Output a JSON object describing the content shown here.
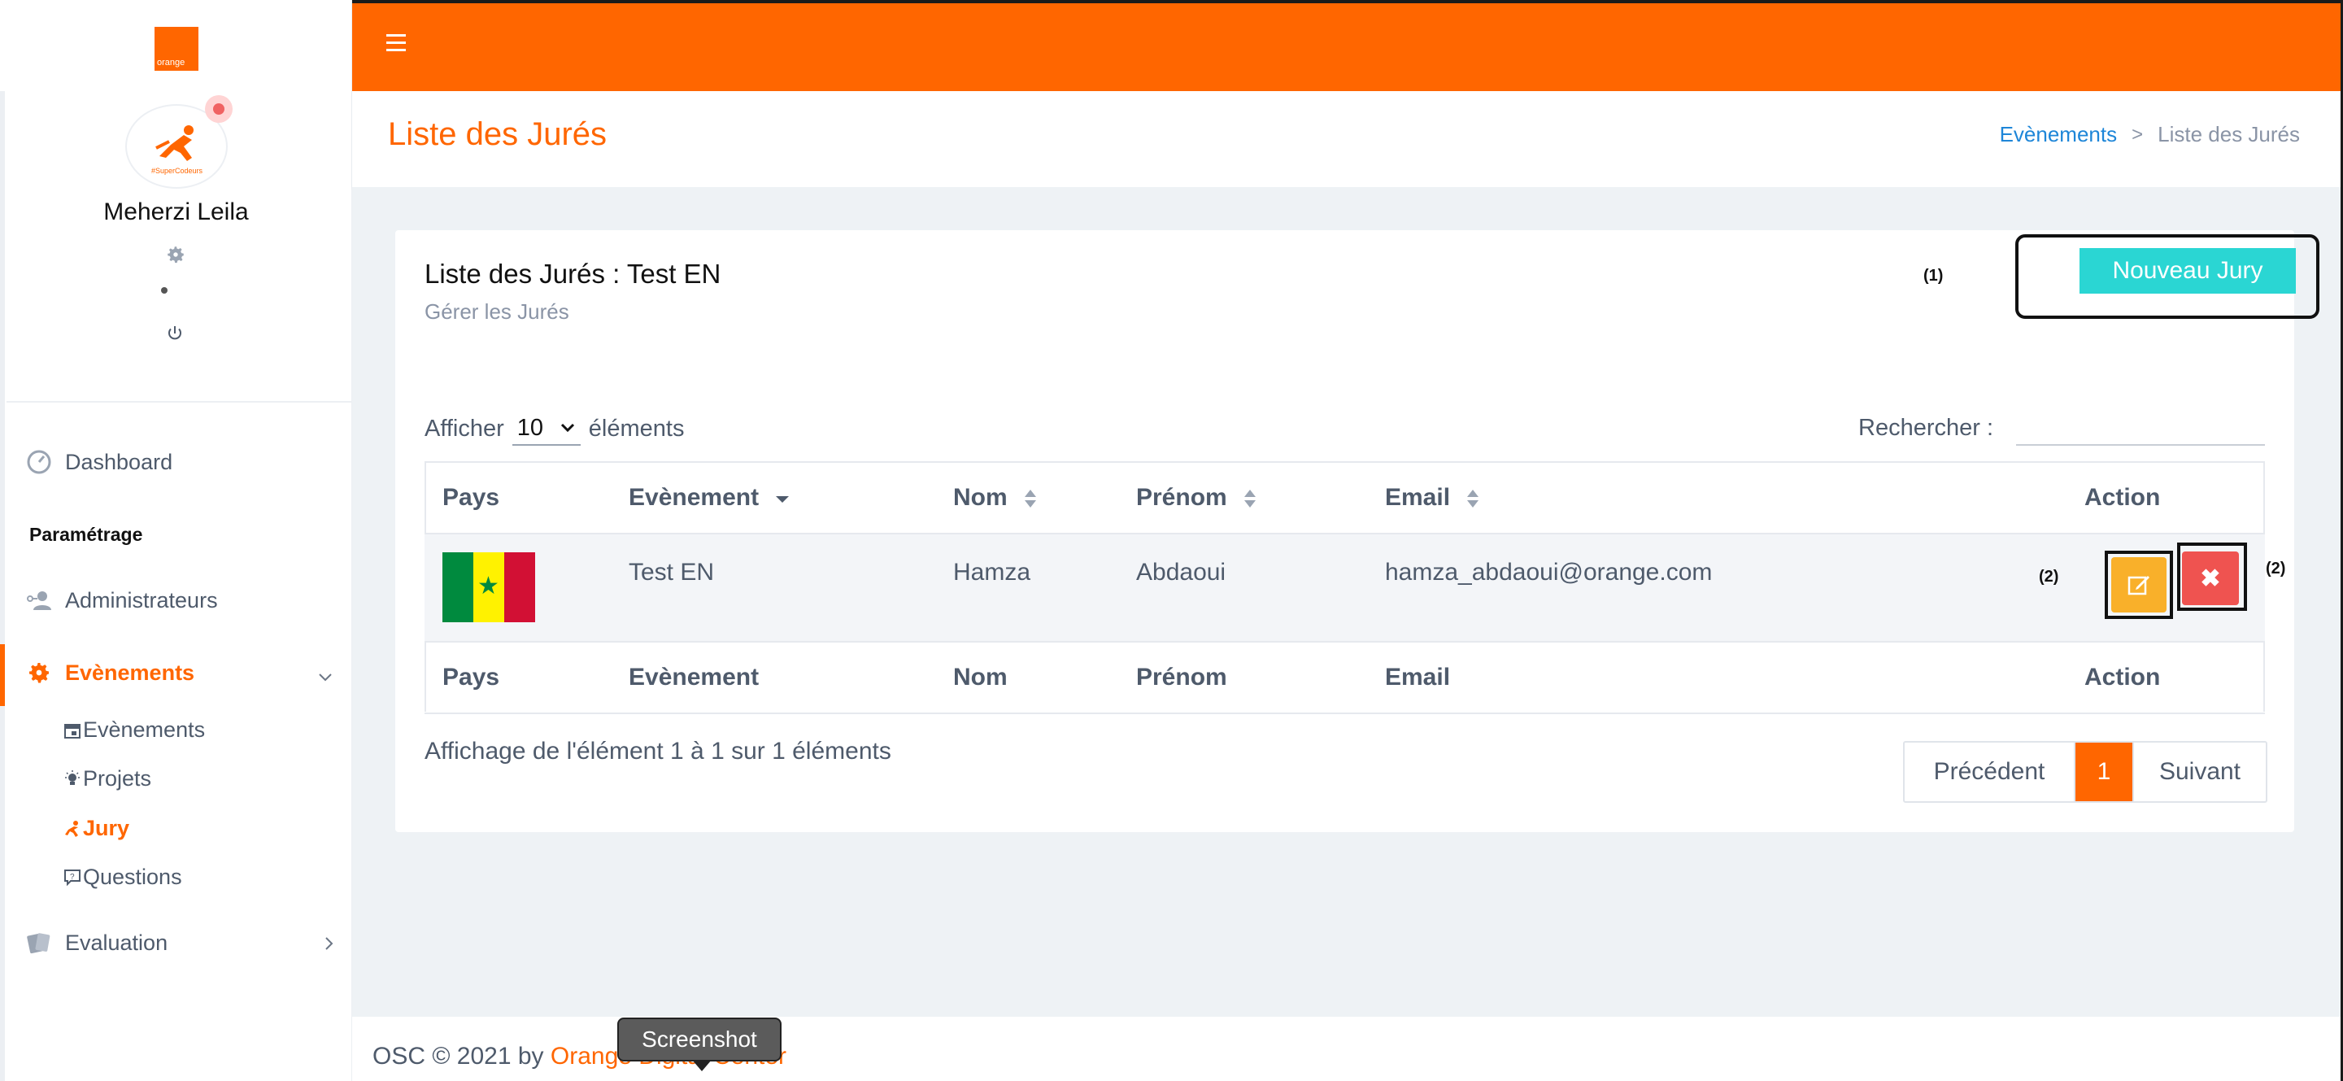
{
  "app": {
    "logo_text": "orange",
    "user": {
      "name": "Meherzi Leila",
      "avatar_caption": "#SuperCodeurs"
    }
  },
  "sidebar": {
    "dashboard": "Dashboard",
    "section": "Paramétrage",
    "administrateurs": "Administrateurs",
    "evenements": "Evènements",
    "sub_items": {
      "evenements": "Evènements",
      "projets": "Projets",
      "jury": "Jury",
      "questions": "Questions"
    },
    "evaluation": "Evaluation"
  },
  "header": {
    "page_title": "Liste des Jurés",
    "breadcrumb": {
      "parent": "Evènements",
      "current": "Liste des Jurés"
    }
  },
  "card": {
    "title": "Liste des Jurés : Test EN",
    "subtitle": "Gérer les Jurés",
    "note_1": "(1)",
    "note_2a": "(2)",
    "note_2b": "(2)",
    "new_button": "Nouveau Jury"
  },
  "table_controls": {
    "show_prefix": "Afficher",
    "show_value": "10",
    "show_suffix": "éléments",
    "search_label": "Rechercher :"
  },
  "table": {
    "columns": [
      "Pays",
      "Evènement",
      "Nom",
      "Prénom",
      "Email",
      "Action"
    ],
    "rows": [
      {
        "pays_flag": "senegal-flag",
        "evenement": "Test EN",
        "nom": "Hamza",
        "prenom": "Abdaoui",
        "email": "hamza_abdaoui@orange.com"
      }
    ]
  },
  "pagination": {
    "info": "Affichage de l'élément 1 à 1 sur 1 éléments",
    "prev": "Précédent",
    "current": "1",
    "next": "Suivant"
  },
  "footer": {
    "prefix": "OSC © 2021 by",
    "brand": "Orange Digital Center",
    "tooltip": "Screenshot"
  },
  "colors": {
    "brand": "#ff6600",
    "accent": "#2ad6d3",
    "edit": "#f9b02a",
    "delete": "#ef5350"
  }
}
